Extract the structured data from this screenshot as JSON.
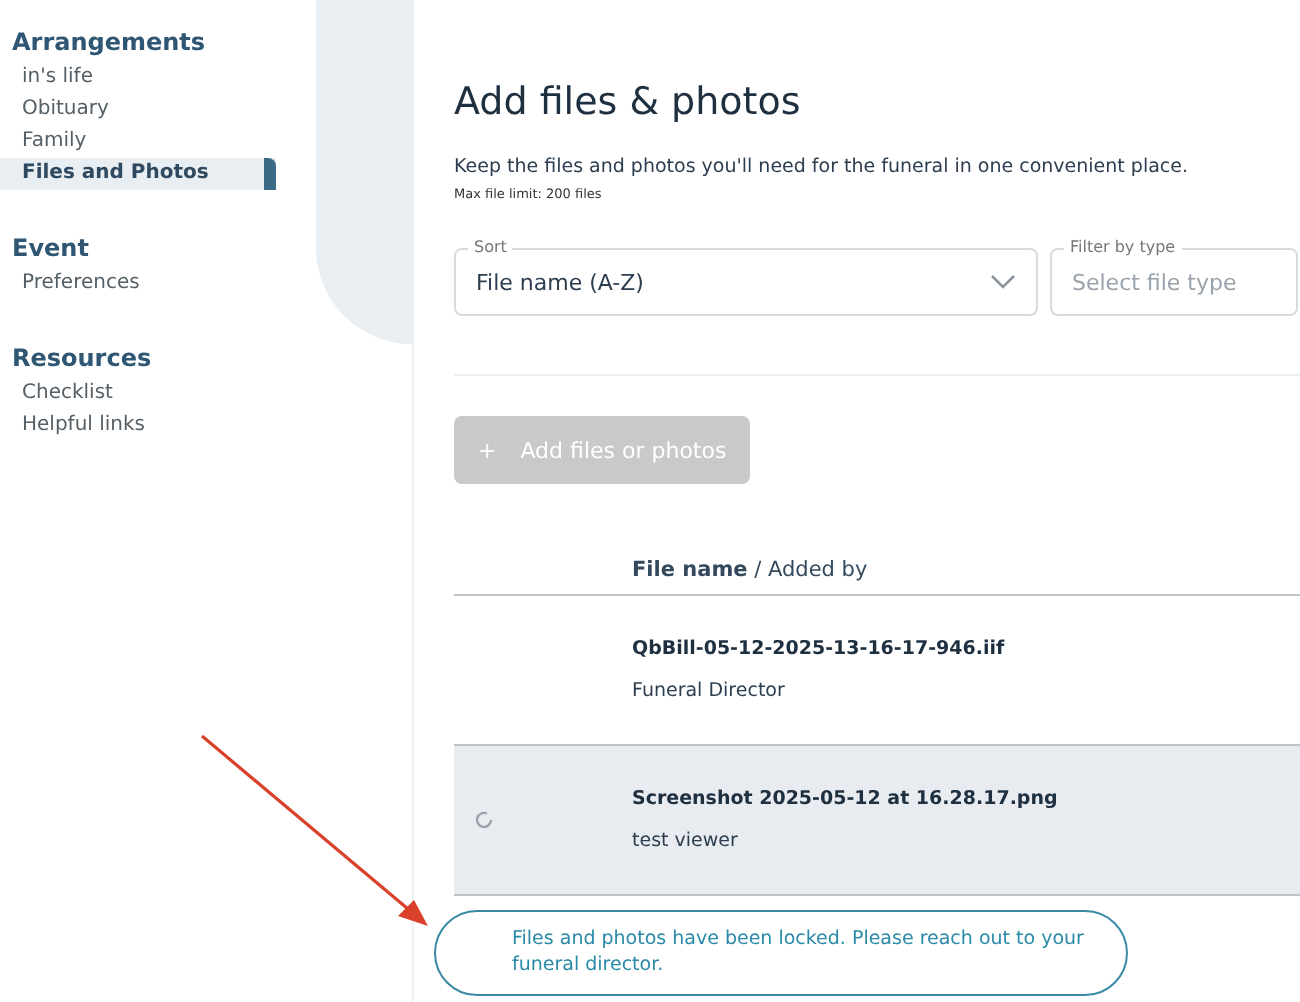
{
  "sidebar": {
    "sections": [
      {
        "title": "Arrangements",
        "items": [
          {
            "label": "in's life",
            "selected": false
          },
          {
            "label": "Obituary",
            "selected": false
          },
          {
            "label": "Family",
            "selected": false
          },
          {
            "label": "Files and Photos",
            "selected": true
          }
        ]
      },
      {
        "title": "Event",
        "items": [
          {
            "label": "Preferences",
            "selected": false
          }
        ]
      },
      {
        "title": "Resources",
        "items": [
          {
            "label": "Checklist",
            "selected": false
          },
          {
            "label": "Helpful links",
            "selected": false
          }
        ]
      }
    ]
  },
  "page": {
    "title": "Add files & photos",
    "description": "Keep the files and photos you'll need for the funeral in one convenient place.",
    "limit_note": "Max file limit: 200 files",
    "sort": {
      "label": "Sort",
      "value": "File name (A-Z)"
    },
    "filter": {
      "label": "Filter by type",
      "placeholder": "Select file type"
    },
    "add_button": {
      "label": "Add files or photos",
      "icon": "+",
      "disabled": true
    },
    "table": {
      "header": "**File name** / Added by",
      "rows": [
        {
          "file_name": "QbBill-05-12-2025-13-16-17-946.iif",
          "added_by": "Funeral Director",
          "selected": false,
          "loading": false
        },
        {
          "file_name": "Screenshot 2025-05-12 at 16.28.17.png",
          "added_by": "test viewer",
          "selected": true,
          "loading": true
        }
      ]
    }
  },
  "toast": {
    "message": "Files and photos have been locked. Please reach out to your funeral director."
  }
}
